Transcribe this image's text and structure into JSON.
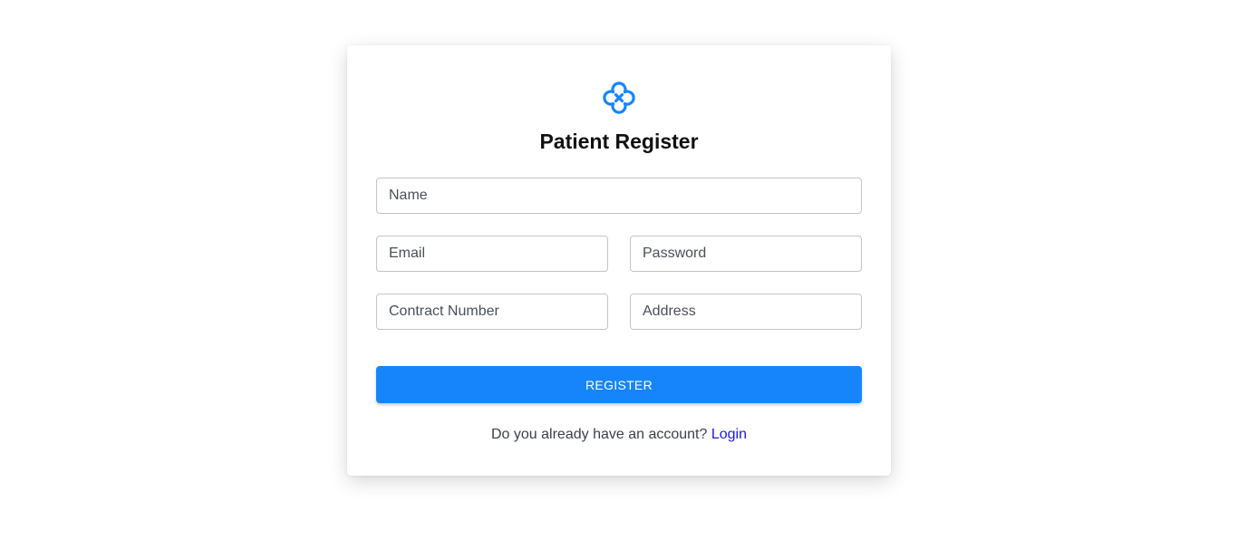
{
  "brand": {
    "accent_color": "#1685fb",
    "logo_icon": "medical-cross-clover-icon"
  },
  "form": {
    "title": "Patient Register",
    "fields": {
      "name": {
        "placeholder": "Name",
        "value": ""
      },
      "email": {
        "placeholder": "Email",
        "value": ""
      },
      "password": {
        "placeholder": "Password",
        "value": ""
      },
      "contract_number": {
        "placeholder": "Contract Number",
        "value": ""
      },
      "address": {
        "placeholder": "Address",
        "value": ""
      }
    },
    "submit_label": "REGISTER"
  },
  "footer": {
    "prompt": "Do you already have an account?",
    "login_link": "Login"
  }
}
